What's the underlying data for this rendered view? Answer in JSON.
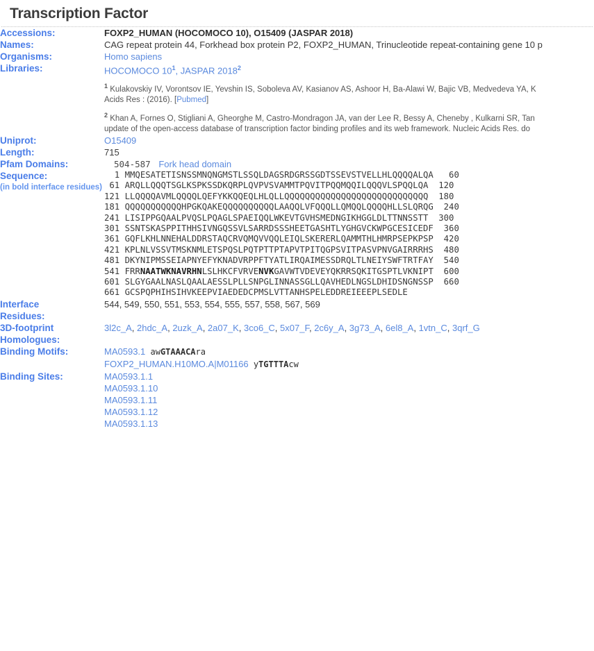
{
  "page": {
    "title": "Transcription Factor"
  },
  "rows": {
    "accessions": {
      "label": "Accessions:",
      "value": "FOXP2_HUMAN (HOCOMOCO 10), O15409 (JASPAR 2018)"
    },
    "names": {
      "label": "Names:",
      "value": "CAG repeat protein 44, Forkhead box protein P2, FOXP2_HUMAN, Trinucleotide repeat-containing gene 10 p"
    },
    "organisms": {
      "label": "Organisms:",
      "value": "Homo sapiens"
    },
    "libraries": {
      "label": "Libraries:",
      "link1": "HOCOMOCO 10",
      "sup1": "1",
      "sep": ", ",
      "link2": "JASPAR 2018",
      "sup2": "2",
      "cite1_sup": "1",
      "cite1_line1": "Kulakovskiy IV, Vorontsov IE, Yevshin IS, Soboleva AV, Kasianov AS, Ashoor H, Ba-Alawi W, Bajic VB, Medvedeva YA, K",
      "cite1_line2": "Acids Res : (2016). [",
      "cite1_pubmed": "Pubmed",
      "cite1_line2b": "]",
      "cite2_sup": "2",
      "cite2_line1": "Khan A, Fornes O, Stigliani A, Gheorghe M, Castro-Mondragon JA, van der Lee R, Bessy A, Cheneby , Kulkarni SR, Tan",
      "cite2_line2": "update of the open-access database of transcription factor binding profiles and its web framework. Nucleic Acids Res. do"
    },
    "uniprot": {
      "label": "Uniprot:",
      "value": "O15409"
    },
    "length": {
      "label": "Length:",
      "value": "715"
    },
    "pfam": {
      "label": "Pfam Domains:",
      "range": "504-587",
      "domain_name": "Fork head domain"
    },
    "sequence": {
      "label": "Sequence:",
      "sublabel": "(in bold interface residues)",
      "lines": [
        {
          "start": "  1",
          "end": " 60",
          "segments": [
            {
              "t": "MMQESATETISNSSMNQNGMSTLSSQLDAGSRDGRSSGDTSSEVSTVELLHLQQQQALQA",
              "b": false
            }
          ]
        },
        {
          "start": " 61",
          "end": "120",
          "segments": [
            {
              "t": "ARQLLQQQTSGLKSPKSSDKQRPLQVPVSVAMMTPQVITPQQMQQILQQQVLSPQQLQA",
              "b": false
            }
          ]
        },
        {
          "start": "121",
          "end": "180",
          "segments": [
            {
              "t": "LLQQQQAVMLQQQQLQEFYKKQQEQLHLQLLQQQQQQQQQQQQQQQQQQQQQQQQQQQQ",
              "b": false
            }
          ]
        },
        {
          "start": "181",
          "end": "240",
          "segments": [
            {
              "t": "QQQQQQQQQQQHPGKQAKEQQQQQQQQQQLAAQQLVFQQQLLQMQQLQQQQHLLSLQRQG",
              "b": false
            }
          ]
        },
        {
          "start": "241",
          "end": "300",
          "segments": [
            {
              "t": "LISIPPGQAALPVQSLPQAGLSPAEIQQLWKEVTGVHSMEDNGIKHGGLDLTTNNSSTT",
              "b": false
            }
          ]
        },
        {
          "start": "301",
          "end": "360",
          "segments": [
            {
              "t": "SSNTSKASPPITHHSIVNGQSSVLSARRDSSSHEETGASHTLYGHGVCKWPGCESICEDF",
              "b": false
            }
          ]
        },
        {
          "start": "361",
          "end": "420",
          "segments": [
            {
              "t": "GQFLKHLNNEHALDDRSTAQCRVQMQVVQQLEIQLSKERERLQAMMTHLHMRPSEPKPSP",
              "b": false
            }
          ]
        },
        {
          "start": "421",
          "end": "480",
          "segments": [
            {
              "t": "KPLNLVSSVTMSKNMLETSPQSLPQTPTTPTAPVTPITQGPSVITPASVPNVGAIRRRHS",
              "b": false
            }
          ]
        },
        {
          "start": "481",
          "end": "540",
          "segments": [
            {
              "t": "DKYNIPMSSEIAPNYEFYKNADVRPPFTYATLIRQAIMESSDRQLTLNEIYSWFTRTFAY",
              "b": false
            }
          ]
        },
        {
          "start": "541",
          "end": "600",
          "segments": [
            {
              "t": "FRR",
              "b": false
            },
            {
              "t": "NAATW",
              "b": true
            },
            {
              "t": "KNAVRHN",
              "b": true
            },
            {
              "t": "LSLHKCFVRVE",
              "b": false
            },
            {
              "t": "NVK",
              "b": true
            },
            {
              "t": "GAVWTVDEVEYQKRRSQKITGSPTLVKNIPT",
              "b": false
            }
          ]
        },
        {
          "start": "601",
          "end": "660",
          "segments": [
            {
              "t": "SLGYGAALNASLQAALAESSLPLLSNPGLINNASSGLLQAVHEDLNGSLDHIDSNGNSSP",
              "b": false
            }
          ]
        },
        {
          "start": "661",
          "end": "",
          "segments": [
            {
              "t": "GCSPQPHIHSIHVKEEPVIAEDEDCPMSLVTTANHSPELEDDREIEEEPLSEDLE",
              "b": false
            }
          ]
        }
      ]
    },
    "interface_residues": {
      "label_line1": "Interface",
      "label_line2": "Residues:",
      "value": "544, 549, 550, 551, 553, 554, 555, 557, 558, 567, 569"
    },
    "homologues": {
      "label_line1": "3D-footprint",
      "label_line2": "Homologues:",
      "items": [
        "3l2c_A",
        "2hdc_A",
        "2uzk_A",
        "2a07_K",
        "3co6_C",
        "5x07_F",
        "2c6y_A",
        "3g73_A",
        "6el8_A",
        "1vtn_C",
        "3qrf_G"
      ]
    },
    "binding_motifs": {
      "label": "Binding Motifs:",
      "items": [
        {
          "id": "MA0593.1",
          "seq_pre": "aw",
          "seq_core": "GTAAACA",
          "seq_post": "ra"
        },
        {
          "id": "FOXP2_HUMAN.H10MO.A|M01166",
          "seq_pre": "y",
          "seq_core": "TGTTTA",
          "seq_post": "cw"
        }
      ]
    },
    "binding_sites": {
      "label": "Binding Sites:",
      "items": [
        "MA0593.1.1",
        "MA0593.1.10",
        "MA0593.1.11",
        "MA0593.1.12",
        "MA0593.1.13"
      ]
    }
  },
  "colors": {
    "label_blue": "#4a7de8",
    "link_blue": "#5b8ade",
    "text_dark": "#3a3a3a"
  }
}
